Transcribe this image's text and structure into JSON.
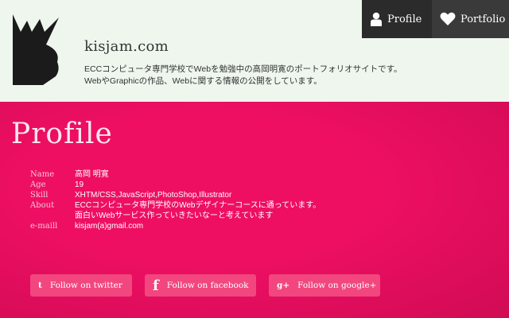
{
  "header": {
    "site_title": "kisjam.com",
    "tagline_line1": "ECCコンピュータ専門学校でWebを勉強中の高岡明寛のポートフォリオサイトです。",
    "tagline_line2": "WebやGraphicの作品、Webに関する情報の公開をしています。"
  },
  "nav": {
    "profile": "Profile",
    "portfolio": "Portfolio"
  },
  "section": {
    "title": "Profile"
  },
  "profile": [
    {
      "key": "Name",
      "value": "高岡 明寛"
    },
    {
      "key": "Age",
      "value": "19"
    },
    {
      "key": "Skill",
      "value": "XHTM/CSS,JavaScript,PhotoShop,Illustrator"
    },
    {
      "key": "About",
      "value": "ECCコンピュータ専門学校のWebデザイナーコースに通っています。"
    },
    {
      "key": "",
      "value": "面白いWebサービス作っていきたいなーと考えています"
    },
    {
      "key": "e-maill",
      "value": "kisjam(a)gmail.com"
    }
  ],
  "follow": {
    "twitter": "Follow on twitter",
    "facebook": "Follow on facebook",
    "google": "Follow on google+"
  },
  "icons": {
    "twitter": "t",
    "facebook": "f",
    "google": "g+"
  },
  "colors": {
    "accent": "#ee0f63",
    "header_bg": "#eef6ee",
    "nav_bg": "#2b2b2b",
    "button_bg": "#f2467f"
  }
}
